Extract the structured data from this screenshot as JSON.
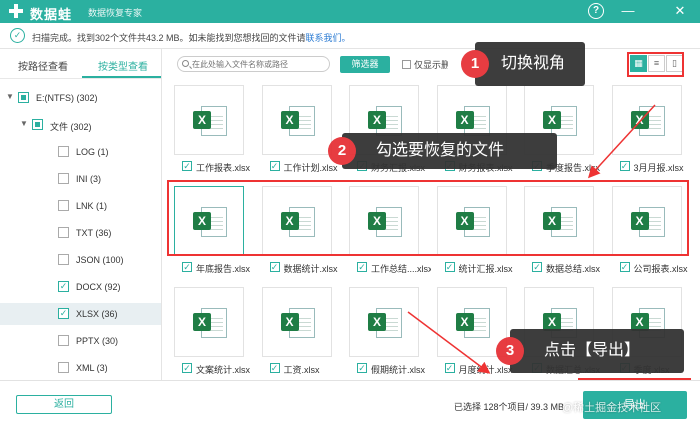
{
  "app": {
    "name": "数据蛙",
    "subtitle": "数据恢复专家"
  },
  "window": {
    "help": "?",
    "minimize": "—",
    "close": "✕"
  },
  "scan": {
    "status": "扫描完成。找到302个文件共43.2 MB。如未能找到您想找回的文件请",
    "link": "联系我们。"
  },
  "sidebar": {
    "tabs": [
      "按路径查看",
      "按类型查看"
    ],
    "active_tab": 1,
    "tree": [
      {
        "label": "E:(NTFS) (302)",
        "level": 0,
        "state": "partial",
        "expand": "▼"
      },
      {
        "label": "文件 (302)",
        "level": 1,
        "state": "partial",
        "expand": "▼"
      },
      {
        "label": "LOG (1)",
        "level": 2,
        "state": "none"
      },
      {
        "label": "INI (3)",
        "level": 2,
        "state": "none"
      },
      {
        "label": "LNK (1)",
        "level": 2,
        "state": "none"
      },
      {
        "label": "TXT (36)",
        "level": 2,
        "state": "none"
      },
      {
        "label": "JSON (100)",
        "level": 2,
        "state": "none"
      },
      {
        "label": "DOCX (92)",
        "level": 2,
        "state": "checked"
      },
      {
        "label": "XLSX (36)",
        "level": 2,
        "state": "checked",
        "selected": true
      },
      {
        "label": "PPTX (30)",
        "level": 2,
        "state": "none"
      },
      {
        "label": "XML (3)",
        "level": 2,
        "state": "none"
      }
    ]
  },
  "toolbar": {
    "search_placeholder": "在此处输入文件名称或路径",
    "filter_label": "筛选器",
    "only_deleted_label": "仅显示删除",
    "view_icons": [
      "grid-view-icon",
      "list-view-icon",
      "preview-view-icon"
    ]
  },
  "files": {
    "row1": [
      "工作报表.xlsx",
      "工作计划.xlsx",
      "财务汇报.xlsx",
      "财务报表.xlsx",
      "季度报告.xlsx",
      "3月月报.xlsx"
    ],
    "row2": [
      "年底报告.xlsx",
      "数据统计.xlsx",
      "工作总结....xlsx",
      "统计汇报.xlsx",
      "数据总结.xlsx",
      "公司报表.xlsx"
    ],
    "row3": [
      "文案统计.xlsx",
      "工资.xlsx",
      "假期统计.xlsx",
      "月度统计.xlsx",
      "数据汇总.xlsx",
      "季度.xlsx"
    ],
    "badge": "X"
  },
  "callouts": [
    {
      "num": "1",
      "text": "切换视角"
    },
    {
      "num": "2",
      "text": "勾选要恢复的文件"
    },
    {
      "num": "3",
      "text": "点击【导出】"
    }
  ],
  "bottom": {
    "back_label": "返回",
    "selection_info": "已选择 128个项目/ 39.3 MB",
    "export_label": "导出"
  },
  "watermark": "@稀土掘金技术社区",
  "colors": {
    "accent": "#2bb0a0",
    "highlight": "#e33333",
    "excel": "#1f7d45"
  }
}
